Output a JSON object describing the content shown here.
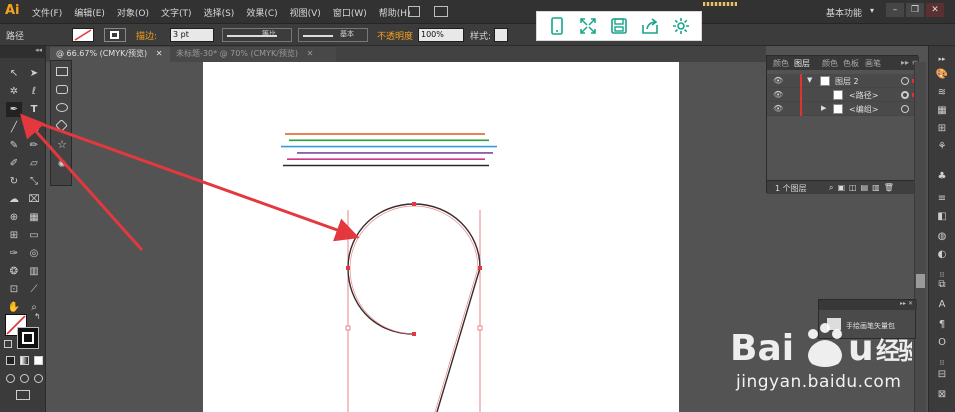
{
  "app": {
    "logo": "Ai"
  },
  "menu": [
    "文件(F)",
    "编辑(E)",
    "对象(O)",
    "文字(T)",
    "选择(S)",
    "效果(C)",
    "视图(V)",
    "窗口(W)",
    "帮助(H)"
  ],
  "workspace": {
    "label": "基本功能",
    "arrow": "▾"
  },
  "window_controls": {
    "minimize": "–",
    "restore": "❐",
    "close": "✕"
  },
  "control_bar": {
    "object_label": "路径",
    "stroke_label": "描边:",
    "stroke_weight": "3 pt",
    "profile_label": "等比",
    "brush_label": "基本",
    "opacity_label": "不透明度",
    "opacity_value": "100%",
    "style_label": "样式:"
  },
  "tabs": [
    {
      "label": "@ 66.67% (CMYK/预览)",
      "close": "✕"
    },
    {
      "label": "未标题-30* @ 70% (CMYK/预览)",
      "close": "✕"
    }
  ],
  "layers_panel": {
    "tabs": [
      "颜色",
      "图层",
      "颜色",
      "色板",
      "画笔"
    ],
    "rows": [
      {
        "name": "图层 2",
        "eye": "👁"
      },
      {
        "name": "<路径>",
        "eye": "👁"
      },
      {
        "name": "<编组>",
        "eye": "👁"
      }
    ],
    "footer": "1 个图层"
  },
  "brush_panel": {
    "label": "手绘画笔矢量包"
  },
  "watermark": {
    "text": "jingyan.baidu.com"
  },
  "colors": {
    "accent_orange": "#f7a21b",
    "arrow_red": "#e3383d",
    "guide_pink": "#e8868a",
    "stroke_lines": [
      "#e05a1a",
      "#2f9e3c",
      "#3b9bd9",
      "#7b4aa3",
      "#d1348a",
      "#2a2a2a"
    ]
  }
}
